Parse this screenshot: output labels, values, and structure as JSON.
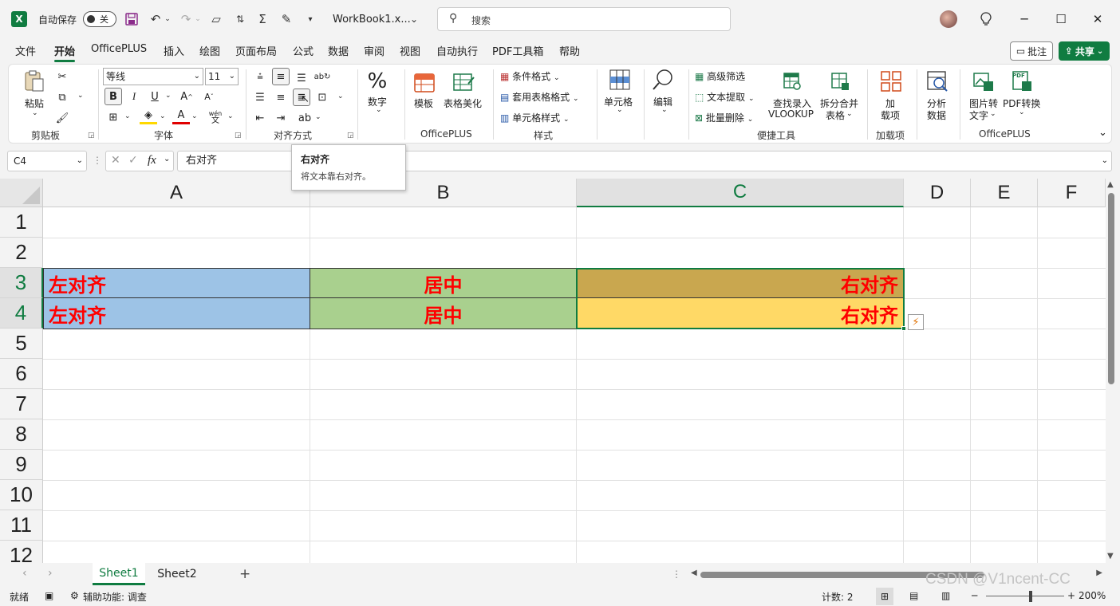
{
  "titlebar": {
    "app_icon": "X",
    "autosave_label": "自动保存",
    "autosave_state": "关",
    "doc_name": "WorkBook1.x...",
    "search_placeholder": "搜索"
  },
  "menu": {
    "tabs": [
      "文件",
      "开始",
      "OfficePLUS",
      "插入",
      "绘图",
      "页面布局",
      "公式",
      "数据",
      "审阅",
      "视图",
      "自动执行",
      "PDF工具箱",
      "帮助"
    ],
    "active": "开始",
    "comment_label": "批注",
    "share_label": "共享"
  },
  "ribbon": {
    "clipboard": {
      "paste": "粘贴",
      "group": "剪贴板"
    },
    "font": {
      "name": "等线",
      "size": "11",
      "bold": "B",
      "italic": "I",
      "underline": "U",
      "grow": "A",
      "shrink": "A",
      "color_a": "A",
      "wen": "wén",
      "wen_sub": "文",
      "group": "字体"
    },
    "alignment": {
      "group": "对齐方式"
    },
    "number": {
      "label": "数字"
    },
    "officeplus": {
      "template": "模板",
      "table_beautify": "表格美化",
      "group": "OfficePLUS"
    },
    "styles": {
      "cond_format": "条件格式",
      "table_style": "套用表格格式",
      "cell_style": "单元格样式",
      "group": "样式"
    },
    "cells": {
      "label": "单元格"
    },
    "editing": {
      "label": "编辑"
    },
    "quick_tools": {
      "adv_filter": "高级筛选",
      "text_extract": "文本提取",
      "batch_delete": "批量删除",
      "vlookup_1": "查找录入",
      "vlookup_2": "VLOOKUP",
      "split_merge_1": "拆分合并",
      "split_merge_2": "表格",
      "group": "便捷工具"
    },
    "addins": {
      "label_1": "加",
      "label_2": "载项",
      "group": "加载项"
    },
    "analyze": {
      "label_1": "分析",
      "label_2": "数据"
    },
    "officeplus2": {
      "img2text_1": "图片转",
      "img2text_2": "文字",
      "pdf_convert": "PDF转换",
      "pdf_badge": "PDF",
      "group": "OfficePLUS"
    }
  },
  "tooltip": {
    "title": "右对齐",
    "desc": "将文本靠右对齐。"
  },
  "formula_bar": {
    "name_box": "C4",
    "fx": "fx",
    "content": "右对齐"
  },
  "grid": {
    "columns": [
      "A",
      "B",
      "C",
      "D",
      "E",
      "F"
    ],
    "selected_column": "C",
    "rows": [
      "1",
      "2",
      "3",
      "4",
      "5",
      "6",
      "7",
      "8",
      "9",
      "10",
      "11",
      "12"
    ],
    "selected_rows": [
      "3",
      "4"
    ],
    "cells": {
      "A3": "左对齐",
      "B3": "居中",
      "C3": "右对齐",
      "A4": "左对齐",
      "B4": "居中",
      "C4": "右对齐"
    },
    "fill_colors": {
      "A": "#9dc3e6",
      "B": "#a9d08e",
      "C3": "#c9a74f",
      "C4": "#ffd966"
    },
    "text_color": "#ff0000"
  },
  "sheets": {
    "tabs": [
      "Sheet1",
      "Sheet2"
    ],
    "active": "Sheet1"
  },
  "status": {
    "ready": "就绪",
    "accessibility": "辅助功能: 调查",
    "count": "计数: 2",
    "zoom": "200%"
  },
  "watermark": "CSDN @V1ncent-CC"
}
